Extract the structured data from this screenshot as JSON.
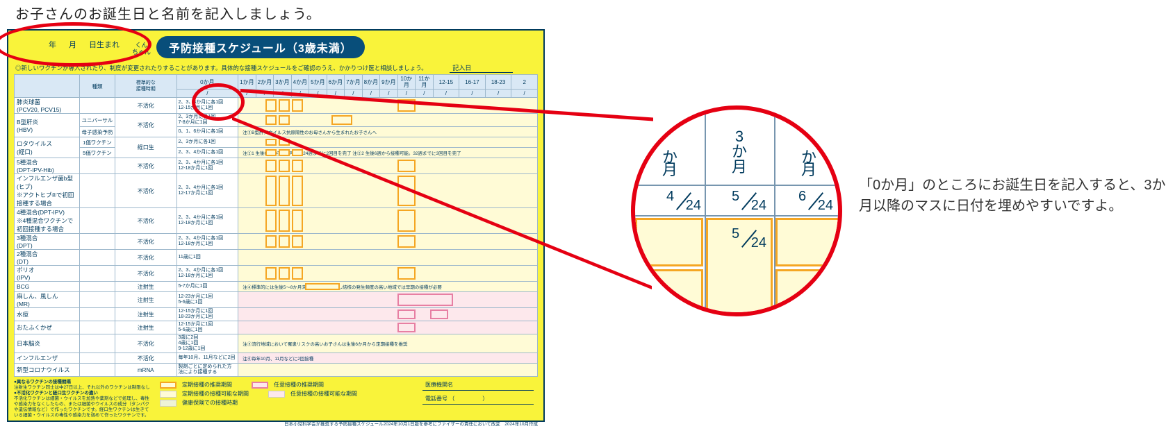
{
  "instruction_top": "お子さんのお誕生日と名前を記入しましょう。",
  "card": {
    "title": "予防接種スケジュール（3歳未満）",
    "birth_labels": {
      "year": "年",
      "month": "月",
      "day": "日生まれ",
      "suffix": "くん\nちゃん"
    },
    "note_line": "◎新しいワクチンが導入されたり、制度が変更されたりすることがあります。具体的な接種スケジュールをご確認のうえ、かかりつけ医と相談しましょう。",
    "entry_date_label": "記入日",
    "header_cols": {
      "type": "種類",
      "timing": "標準的な\n接種時期"
    },
    "months": [
      "0か月",
      "1か月",
      "2か月",
      "3か月",
      "4か月",
      "5か月",
      "6か月",
      "7か月",
      "8か月",
      "9か月",
      "10か月",
      "11か月",
      "12-15",
      "16-17",
      "18-23",
      "2"
    ],
    "slash_row_count": 16,
    "vaccines": [
      {
        "name": "肺炎球菌\n(PCV20, PCV15)",
        "type": "不活化",
        "timing": "2、3、4か月に各1回\n12-15か月に1回"
      },
      {
        "name": "B型肝炎\n(HBV)",
        "sub": [
          "ユニバーサル",
          "母子感染予防"
        ],
        "type": "不活化",
        "timing": [
          "2、3か月に各1回\n7-8か月に1回",
          "0、1、6か月に各1回"
        ],
        "note": "注③B型肝炎ウイルス抗原陽性のお母さんから生まれたお子さんへ"
      },
      {
        "name": "ロタウイルス\n(経口)",
        "sub": [
          "1価ワクチン",
          "5価ワクチン"
        ],
        "type": "経口生",
        "timing": [
          "2、3か月に各1回",
          "2、3、4か月に各1回"
        ],
        "note": "注②1 生後6週から接種可能。24週までに2回目を完了\n注②2 生後6週から接種可能。32週までに3回目を完了"
      },
      {
        "name": "5種混合\n(DPT-IPV-Hib)",
        "type": "不活化",
        "timing": "2、3、4か月に各1回\n12-18か月に1回"
      },
      {
        "name": "インフルエンザ菌b型(ヒブ)\n※アクトヒブ®で初回接種する場合",
        "type": "不活化",
        "timing": "2、3、4か月に各1回\n12-17か月に1回"
      },
      {
        "name": "4種混合(DPT-IPV)\n※4種混合ワクチンで初回接種する場合",
        "type": "不活化",
        "timing": "2、3、4か月に各1回\n12-18か月に1回"
      },
      {
        "name": "3種混合\n(DPT)",
        "type": "不活化",
        "timing": "2、3、4か月に各1回\n12-18か月に1回"
      },
      {
        "name": "2種混合\n(DT)",
        "type": "不活化",
        "timing": "11歳に1回"
      },
      {
        "name": "ポリオ\n(IPV)",
        "type": "不活化",
        "timing": "2、3、4か月に各1回\n12-18か月に1回"
      },
      {
        "name": "BCG",
        "type": "注射生",
        "timing": "5-7か月に1回",
        "note": "注④標準的には生後5～8か月未満に接種。ただし結核の発生頻度の高い地域では早期の接種が必要"
      },
      {
        "name": "麻しん、風しん\n(MR)",
        "type": "注射生",
        "timing": "12-23か月に1回\n5-6歳に1回"
      },
      {
        "name": "水痘",
        "type": "注射生",
        "timing": "12-15か月に1回\n18-23か月に1回"
      },
      {
        "name": "おたふくかぜ",
        "type": "注射生",
        "timing": "12-15か月に1回\n5-6歳に1回"
      },
      {
        "name": "日本脳炎",
        "type": "不活化",
        "timing": "3歳に2回\n4歳に1回\n9-12歳に1回",
        "note": "注⑤流行地域において罹患リスクの高いお子さんは生後6か月から定期接種を推奨"
      },
      {
        "name": "インフルエンザ",
        "type": "不活化",
        "timing": "毎年10月、11月などに2回",
        "note": "注⑥毎年10月、11月などに2回接種"
      },
      {
        "name": "新型コロナウイルス",
        "type": "mRNA",
        "timing": "製剤ごとに定められた方法により接種する"
      }
    ],
    "footer_left": {
      "h1": "●異なるワクチンの接種間隔",
      "t1": "注射生ワクチン同士は中27日以上、それ以外のワクチンは制限なし",
      "h2": "●不活化ワクチンと経口生ワクチンの違い",
      "t2": "不活化ワクチンは細菌・ウイルスを加熱や薬剤などで処理し、毒性や感染力をなくしたもの、または細菌やウイルスの成分（タンパクや遺伝情報など）で作ったワクチンです。経口生ワクチンは生きている細菌・ウイルスの毒性や感染力を弱めて作ったワクチンです。"
    },
    "legend": {
      "l1": "定期接種の推奨期間",
      "l2": "定期接種の接種可能な期間",
      "l3": "健康保険での接種時期",
      "l4": "任意接種の推奨期間",
      "l5": "任意接種の接種可能な期間"
    },
    "footer_right": {
      "facility": "医療機関名",
      "phone": "電話番号",
      "paren": "（　　　　　）"
    },
    "credit": "日本小児科学会が推奨する予防接種スケジュール2024年10月1日版を参考にファイザーの責任において改変　2024年10月作成"
  },
  "zoom": {
    "months": [
      "か月",
      "3\nか\n月",
      "か月"
    ],
    "dates": [
      "4/24",
      "5/24",
      "6/24"
    ],
    "center_date": "5/24"
  },
  "side_text": "「0か月」のところにお誕生日を記入すると、3か月以降のマスに日付を埋めやすいですよ。"
}
